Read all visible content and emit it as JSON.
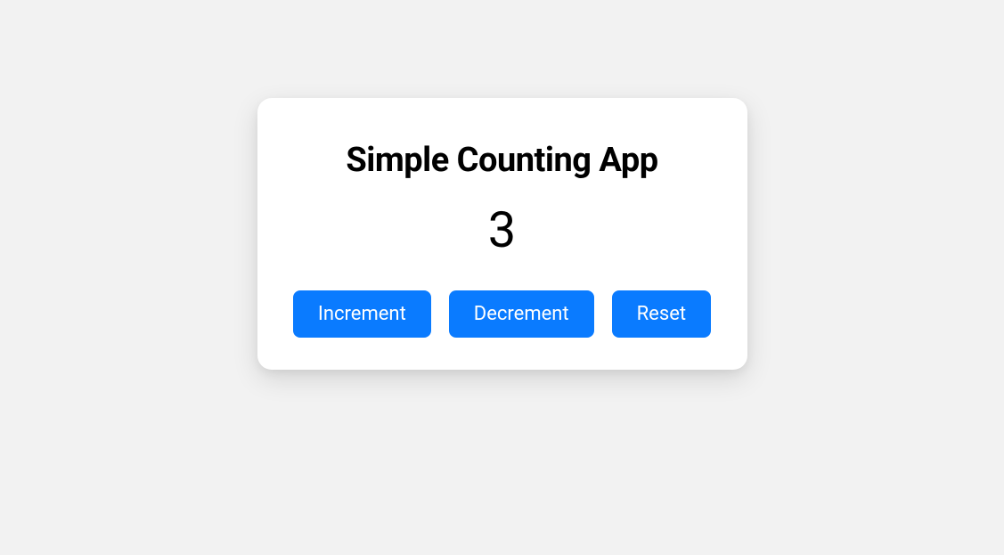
{
  "title": "Simple Counting App",
  "count": "3",
  "buttons": {
    "increment": "Increment",
    "decrement": "Decrement",
    "reset": "Reset"
  }
}
